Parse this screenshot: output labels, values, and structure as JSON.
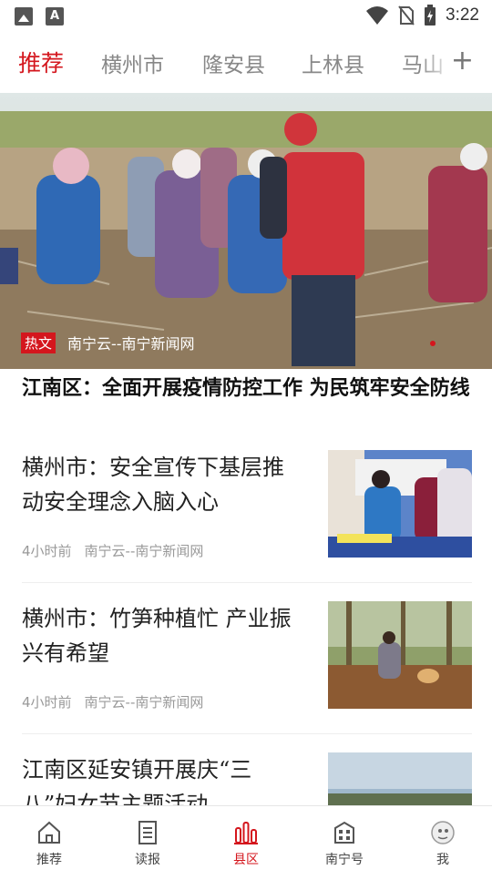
{
  "status_bar": {
    "time": "3:22"
  },
  "tabs": [
    {
      "label": "推荐",
      "active": true
    },
    {
      "label": "横州市"
    },
    {
      "label": "隆安县"
    },
    {
      "label": "上林县"
    },
    {
      "label": "马山"
    }
  ],
  "add_tab_symbol": "+",
  "banner": {
    "tag": "热文",
    "source": "南宁云--南宁新闻网",
    "headline": "江南区：全面开展疫情防控工作 为民筑牢安全防线"
  },
  "news": [
    {
      "title": "横州市：安全宣传下基层推动安全理念入脑入心",
      "time": "4小时前",
      "source": "南宁云--南宁新闻网"
    },
    {
      "title": "横州市：竹笋种植忙 产业振兴有希望",
      "time": "4小时前",
      "source": "南宁云--南宁新闻网"
    },
    {
      "title": "江南区延安镇开展庆“三八”妇女节主题活动",
      "time": "",
      "source": ""
    }
  ],
  "bottom_nav": [
    {
      "label": "推荐",
      "icon": "home-icon"
    },
    {
      "label": "读报",
      "icon": "newspaper-icon"
    },
    {
      "label": "县区",
      "icon": "county-icon",
      "active": true
    },
    {
      "label": "南宁号",
      "icon": "building-icon"
    },
    {
      "label": "我",
      "icon": "profile-icon"
    }
  ],
  "colors": {
    "accent": "#d4161d",
    "inactive_tab": "#888888",
    "meta": "#999999"
  }
}
